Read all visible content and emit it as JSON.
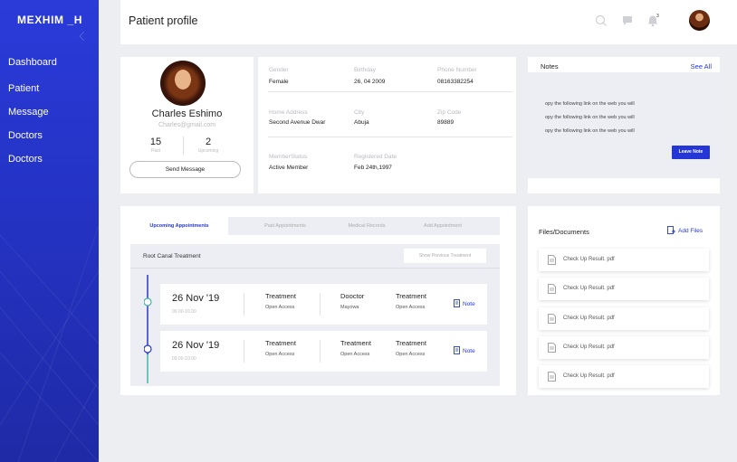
{
  "sidebar": {
    "brand": "MEXHIM _H",
    "items": [
      {
        "label": "Dashboard"
      },
      {
        "label": "Patient"
      },
      {
        "label": "Message"
      },
      {
        "label": "Doctors"
      },
      {
        "label": "Doctors"
      }
    ]
  },
  "header": {
    "title": "Patient profile",
    "notification_count": "3",
    "icons": [
      "search-icon",
      "chat-icon",
      "bell-icon"
    ]
  },
  "profile": {
    "name": "Charles Eshimo",
    "email": "Charles@gmail.com",
    "past_count": "15",
    "past_label": "Past",
    "upcoming_count": "2",
    "upcoming_label": "Upcoming",
    "send_message": "Send Message"
  },
  "info": {
    "gender_label": "Gender",
    "gender": "Female",
    "birthday_label": "Birthday",
    "birthday": "26, 04 2009",
    "phone_label": "Phone Number",
    "phone": "08163382254",
    "address_label": "Home Address",
    "address": "Second Avenue Dwar",
    "city_label": "City",
    "city": "Abuja",
    "zip_label": "Zip Code",
    "zip": "89889",
    "member_label": "MemberStatus",
    "member": "Active Member",
    "registered_label": "Registered Date",
    "registered": "Feb 24th,1997"
  },
  "notes": {
    "title": "Notes",
    "see_all": "See All",
    "lines": [
      "opy the following link on the web you will",
      "opy the following link on the web you will",
      "opy the following link on the web you will"
    ],
    "leave_note": "Leave Note"
  },
  "appointments": {
    "tabs": [
      {
        "label": "Upcoming Appointments",
        "active": true
      },
      {
        "label": "Past Appointments"
      },
      {
        "label": "Medical Records"
      },
      {
        "label": "Add Appointment"
      }
    ],
    "panel_title": "Root Canal Treatment",
    "show_previous": "Show Previous Treatment",
    "items": [
      {
        "date": "26 Nov '19",
        "time": "09.00-10.00",
        "col1_h": "Treatment",
        "col1_s": "Open Access",
        "col2_h": "Dooctor",
        "col2_s": "Mayowa",
        "col3_h": "Treatment",
        "col3_s": "Open Access",
        "note": "Note"
      },
      {
        "date": "26 Nov '19",
        "time": "09.00-10.00",
        "col1_h": "Treatment",
        "col1_s": "Open Access",
        "col2_h": "Treatment",
        "col2_s": "Open Access",
        "col3_h": "Treatment",
        "col3_s": "Open Access",
        "note": "Note"
      }
    ]
  },
  "files": {
    "title": "Files/Documents",
    "add_files": "Add Files",
    "items": [
      "Check Up Result. pdf",
      "Check Up Result. pdf",
      "Check Up Result. pdf",
      "Check Up Result. pdf",
      "Check Up Result. pdf"
    ]
  },
  "colors": {
    "accent": "#2436d6",
    "sidebar": "#2a3bd9",
    "timeline_top": "#2436d6",
    "timeline_bottom": "#3fb8a2"
  }
}
